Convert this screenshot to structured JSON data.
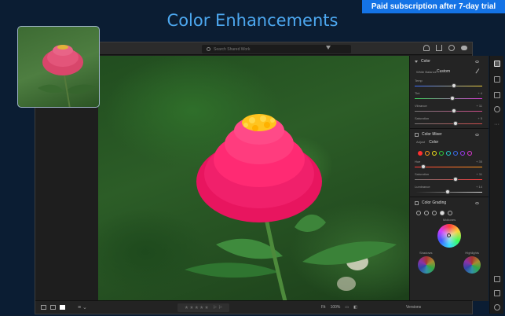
{
  "banner": {
    "text": "Paid subscription after 7-day trial"
  },
  "headline": {
    "text": "Color Enhancements"
  },
  "app": {
    "search": {
      "placeholder": "Search Shared Work"
    },
    "icons": {
      "bell": "bell-icon",
      "share": "share-icon",
      "help": "help-icon",
      "cloud": "cloud-icon",
      "filter": "filter-icon"
    },
    "panel": {
      "color": {
        "title": "Color",
        "white_balance_label": "White Balance",
        "white_balance_value": "Custom",
        "sliders": [
          {
            "label": "Temp",
            "value": "",
            "position": 0.58
          },
          {
            "label": "Tint",
            "value": "+ 4",
            "position": 0.55
          },
          {
            "label": "Vibrance",
            "value": "+ 11",
            "position": 0.58
          },
          {
            "label": "Saturation",
            "value": "+ 5",
            "position": 0.6
          }
        ]
      },
      "color_mixer": {
        "title": "Color Mixer",
        "adjust_label": "Adjust",
        "adjust_value": "Color",
        "swatches": [
          "#ff3030",
          "#ff9a1e",
          "#f2e21b",
          "#2fd13b",
          "#23c9c9",
          "#3a6cf2",
          "#9a3af2",
          "#e23ad7"
        ],
        "sliders": [
          {
            "label": "Hue",
            "value": "+ 35",
            "position": 0.1
          },
          {
            "label": "Saturation",
            "value": "+ 11",
            "position": 0.6
          },
          {
            "label": "Luminance",
            "value": "+ 14",
            "position": 0.48
          }
        ]
      },
      "color_grading": {
        "title": "Color Grading",
        "midtones_label": "Midtones",
        "shadows_label": "Shadows",
        "highlights_label": "Highlights"
      }
    },
    "bottombar": {
      "zoom_label": "Fit",
      "zoom_value": "100%",
      "versions_label": "Versions",
      "flag_label": "⚐ ⚐"
    }
  }
}
